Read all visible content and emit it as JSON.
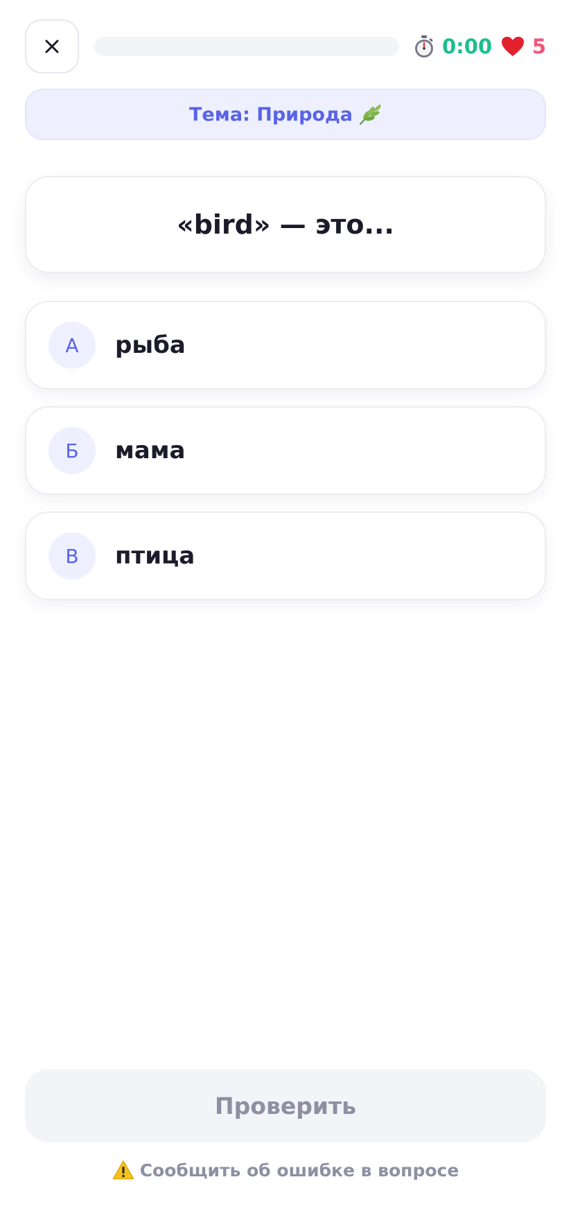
{
  "header": {
    "close_label": "×",
    "progress": 0,
    "timer": "0:00",
    "lives": "5"
  },
  "topic": {
    "label": "Тема: Природа"
  },
  "question": {
    "text": "«bird» — это..."
  },
  "options": [
    {
      "letter": "А",
      "text": "рыба"
    },
    {
      "letter": "Б",
      "text": "мама"
    },
    {
      "letter": "В",
      "text": "птица"
    }
  ],
  "check_button": {
    "label": "Проверить"
  },
  "report": {
    "label": "Сообщить об ошибке в вопросе"
  },
  "icons": {
    "close": "close-icon",
    "timer": "stopwatch-icon",
    "lives": "heart-icon",
    "topic": "leaf-icon",
    "report": "warning-icon"
  },
  "colors": {
    "accent": "#5863e8",
    "timer": "#1bbf8d",
    "lives": "#f0567a",
    "muted": "#8e8fa2"
  }
}
